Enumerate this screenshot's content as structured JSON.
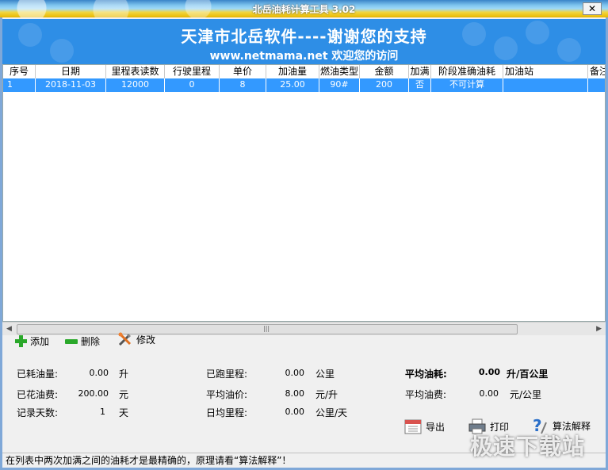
{
  "window": {
    "title": "北岳油耗计算工具 3.02",
    "close": "✕"
  },
  "banner": {
    "title": "天津市北岳软件----谢谢您的支持",
    "subtitle": "www.netmama.net 欢迎您的访问"
  },
  "table": {
    "columns": [
      "序号",
      "日期",
      "里程表读数",
      "行驶里程",
      "单价",
      "加油量",
      "燃油类型",
      "金额",
      "加满",
      "阶段准确油耗",
      "加油站",
      "备注"
    ],
    "rows": [
      [
        "1",
        "2018-11-03",
        "12000",
        "0",
        "8",
        "25.00",
        "90#",
        "200",
        "否",
        "不可计算",
        "",
        ""
      ]
    ]
  },
  "toolbar": {
    "add": "添加",
    "delete": "删除",
    "edit": "修改"
  },
  "stats": {
    "fuel_used_label": "已耗油量:",
    "fuel_used_value": "0.00",
    "fuel_used_unit": "升",
    "fuel_cost_label": "已花油费:",
    "fuel_cost_value": "200.00",
    "fuel_cost_unit": "元",
    "days_label": "记录天数:",
    "days_value": "1",
    "days_unit": "天",
    "distance_label": "已跑里程:",
    "distance_value": "0.00",
    "distance_unit": "公里",
    "avg_price_label": "平均油价:",
    "avg_price_value": "8.00",
    "avg_price_unit": "元/升",
    "daily_label": "日均里程:",
    "daily_value": "0.00",
    "daily_unit": "公里/天",
    "avg_consumption_label": "平均油耗:",
    "avg_consumption_value": "0.00",
    "avg_consumption_unit": "升/百公里",
    "avg_fee_label": "平均油费:",
    "avg_fee_value": "0.00",
    "avg_fee_unit": "元/公里"
  },
  "actions": {
    "export": "导出",
    "print": "打印",
    "algorithm": "算法解释"
  },
  "status": "在列表中两次加满之间的油耗才是最精确的，原理请看“算法解释”！",
  "watermark": "极速下载站"
}
